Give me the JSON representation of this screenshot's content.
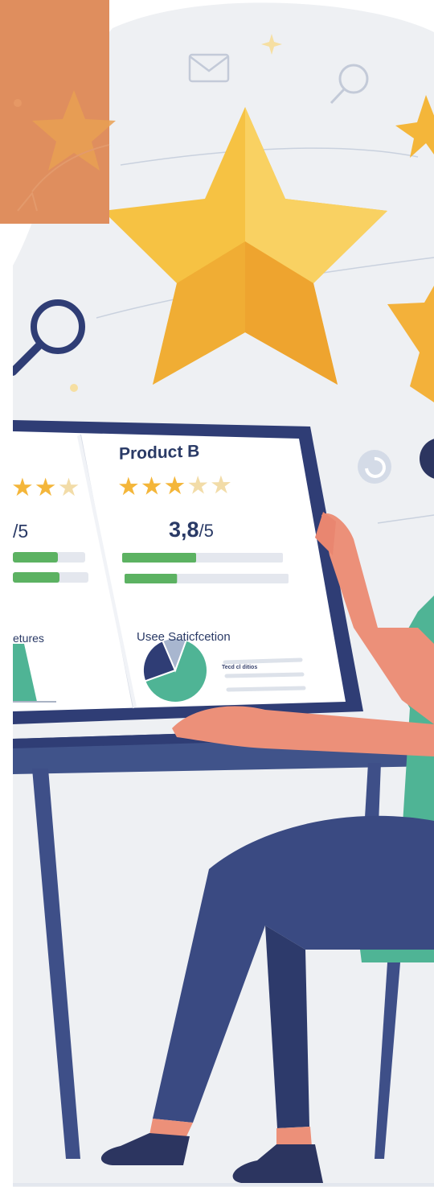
{
  "product_b": {
    "title": "Product B",
    "score": "3,8",
    "score_suffix": "/5",
    "rating_stars": 3.5,
    "satisfaction_label": "Usee Saticfcetion",
    "legend_label": "Tecd cl ditios",
    "bars": [
      0.46,
      0.32
    ]
  },
  "product_a": {
    "score_suffix": "/5",
    "features_label": "etures",
    "bars": [
      0.62,
      0.62
    ]
  },
  "pie": {
    "slices": [
      0.64,
      0.24,
      0.12
    ],
    "colors": [
      "#4fb495",
      "#2f3d75",
      "#a8b6cf"
    ]
  },
  "colors": {
    "star": "#f4b63a",
    "navy": "#2f3d75",
    "teal": "#4fb495",
    "skin": "#ec9079",
    "overlay": "#df8e5e",
    "blob": "#eef0f3"
  },
  "icons": [
    "envelope-icon",
    "magnifier-icon",
    "sparkle-icon",
    "refresh-icon"
  ]
}
